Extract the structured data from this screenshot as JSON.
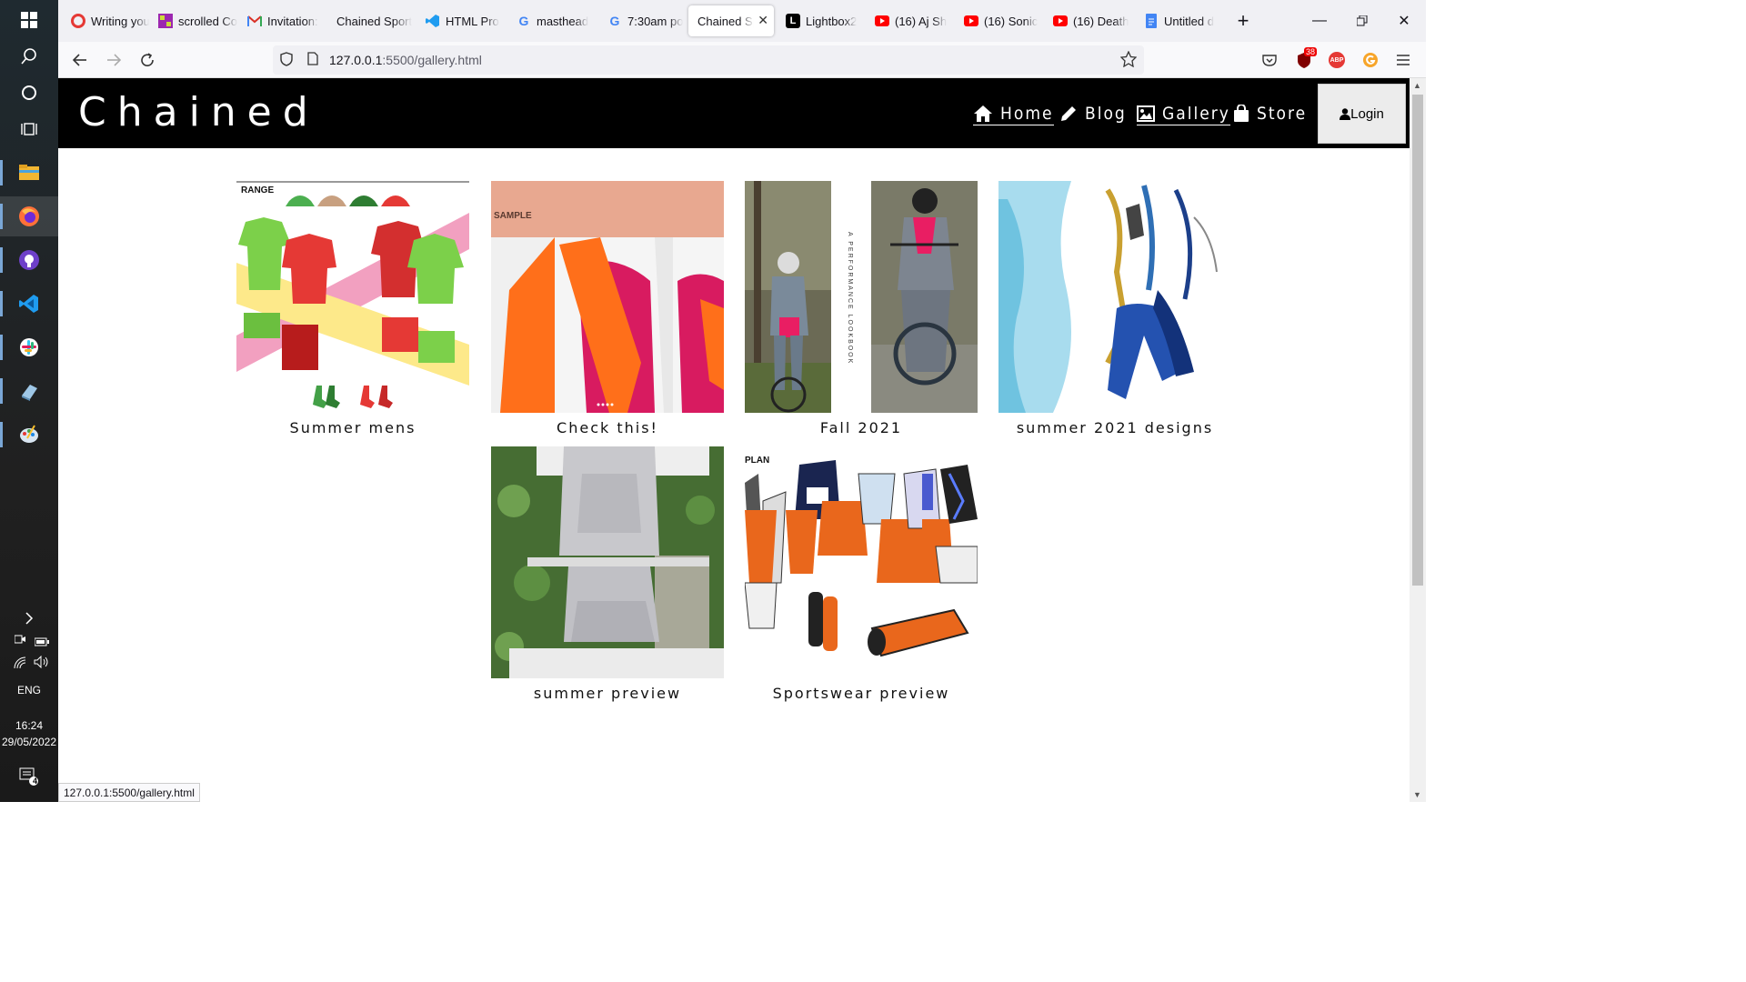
{
  "taskbar": {
    "time": "16:24",
    "date": "29/05/2022",
    "language": "ENG",
    "notification_count": "4"
  },
  "browser": {
    "tabs": [
      {
        "title": "Writing your",
        "icon": "opera-icon",
        "color": "#e53935"
      },
      {
        "title": "scrolled Co",
        "icon": "pixel-app-icon",
        "color": "#9c27b0"
      },
      {
        "title": "Invitation:",
        "icon": "gmail-icon",
        "color": "#d93025"
      },
      {
        "title": "Chained Sport",
        "icon": "",
        "color": ""
      },
      {
        "title": "HTML Pro",
        "icon": "vscode-icon",
        "color": "#0078d4"
      },
      {
        "title": "masthead",
        "icon": "google-icon",
        "color": "#4285f4"
      },
      {
        "title": "7:30am po",
        "icon": "google-icon",
        "color": "#4285f4"
      },
      {
        "title": "Chained Sp",
        "icon": "",
        "color": ""
      },
      {
        "title": "Lightbox2",
        "icon": "lightbox-icon",
        "color": "#000000"
      },
      {
        "title": "(16) Aj Sh",
        "icon": "youtube-icon",
        "color": "#ff0000"
      },
      {
        "title": "(16) Sonic",
        "icon": "youtube-icon",
        "color": "#ff0000"
      },
      {
        "title": "(16) Death",
        "icon": "youtube-icon",
        "color": "#ff0000"
      },
      {
        "title": "Untitled d",
        "icon": "docs-icon",
        "color": "#4285f4"
      }
    ],
    "url_host": "127.0.0.1",
    "url_path": ":5500/gallery.html",
    "status_url": "127.0.0.1:5500/gallery.html",
    "badges": {
      "ublock": "38",
      "abp": "ABP"
    }
  },
  "site": {
    "logo": "Chained",
    "nav": [
      {
        "label": "Home",
        "icon": "home-icon"
      },
      {
        "label": "Blog",
        "icon": "pencil-icon"
      },
      {
        "label": "Gallery",
        "icon": "image-icon"
      },
      {
        "label": "Store",
        "icon": "shopping-bag-icon"
      }
    ],
    "login": "Login"
  },
  "gallery": [
    {
      "caption": "Summer mens",
      "text": "RANGE"
    },
    {
      "caption": "Check this!",
      "text": "SAMPLE"
    },
    {
      "caption": "Fall 2021",
      "text": "A PERFORMANCE LOOKBOOK"
    },
    {
      "caption": "summer 2021 designs",
      "text": ""
    },
    {
      "caption": "summer preview",
      "text": ""
    },
    {
      "caption": "Sportswear preview",
      "text": "PLAN"
    }
  ]
}
